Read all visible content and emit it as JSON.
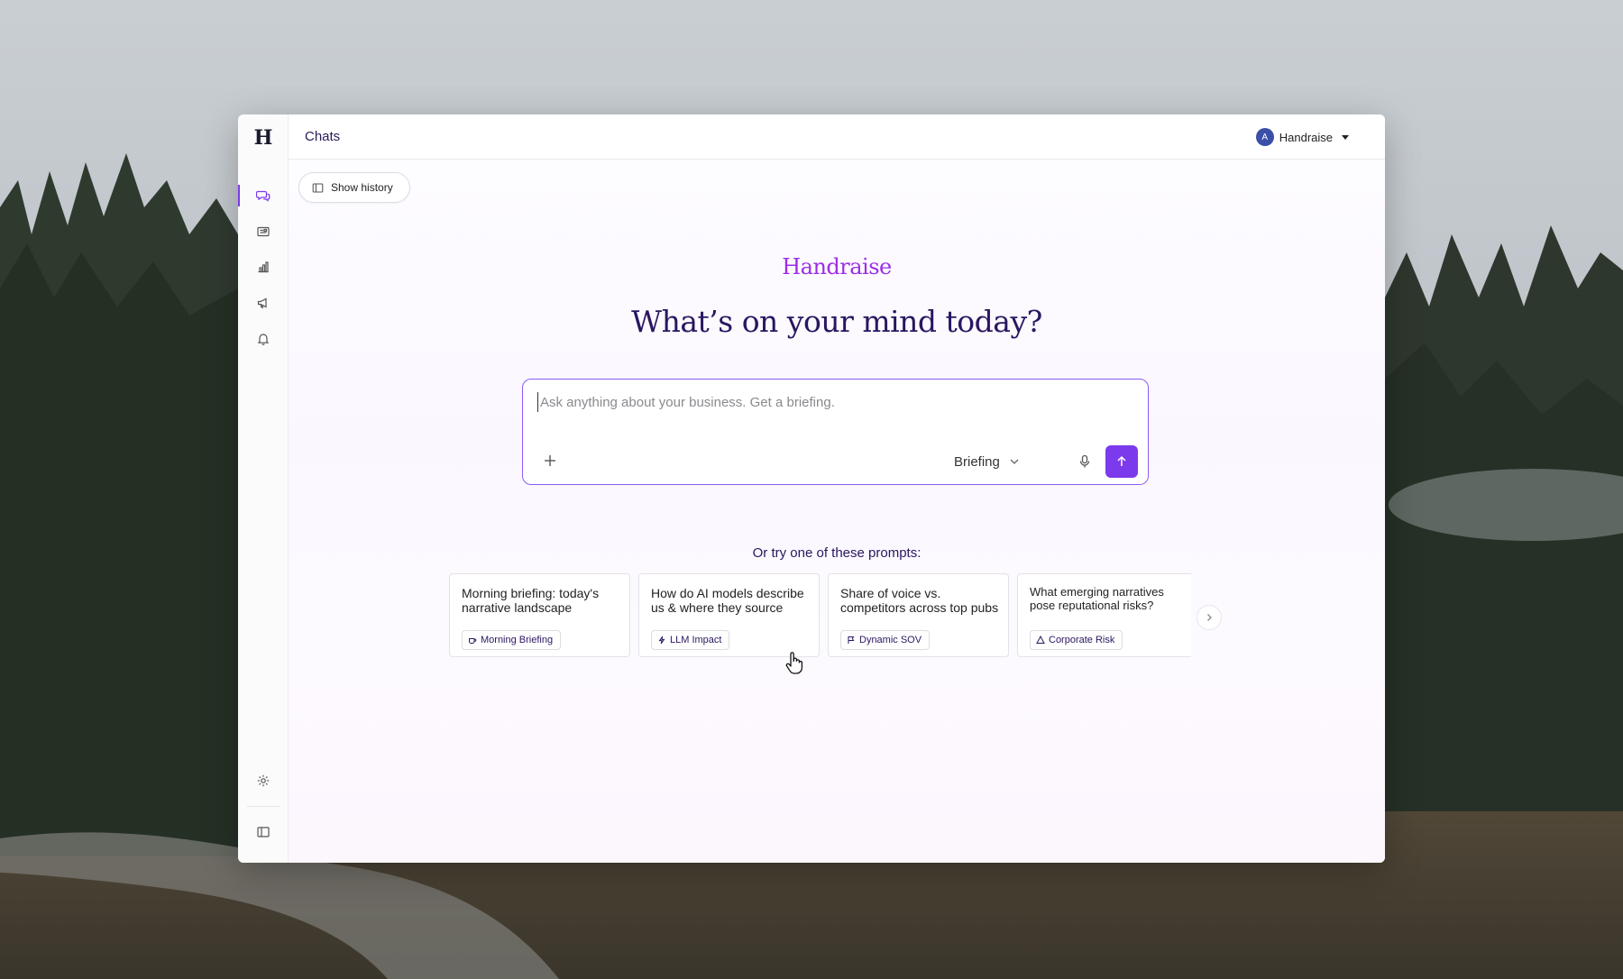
{
  "app": {
    "logo_letter": "H",
    "title": "Chats",
    "account": {
      "avatar_initial": "A",
      "name": "Handraise"
    }
  },
  "rail": {
    "items": [
      {
        "icon": "chat-icon",
        "active": true
      },
      {
        "icon": "newspaper-icon",
        "active": false
      },
      {
        "icon": "bar-chart-icon",
        "active": false
      },
      {
        "icon": "megaphone-icon",
        "active": false
      },
      {
        "icon": "bell-icon",
        "active": false
      }
    ],
    "bottom": [
      {
        "icon": "gear-icon"
      },
      {
        "icon": "sidebar-toggle-icon"
      }
    ]
  },
  "main": {
    "history_button": "Show history",
    "brand": "Handraise",
    "headline": "What’s on your mind today?",
    "composer": {
      "placeholder": "Ask anything about your business. Get a briefing.",
      "value": "",
      "mode": "Briefing"
    },
    "prompts_title": "Or try one of these prompts:",
    "prompts": [
      {
        "text": "Morning briefing: today's narrative landscape",
        "tag": "Morning Briefing",
        "tag_icon": "coffee-icon"
      },
      {
        "text": "How do AI models describe us & where they source",
        "tag": "LLM Impact",
        "tag_icon": "bolt-icon"
      },
      {
        "text": "Share of voice vs. competitors across top pubs",
        "tag": "Dynamic SOV",
        "tag_icon": "flag-icon"
      },
      {
        "text": "What emerging narratives pose reputational risks?",
        "tag": "Corporate Risk",
        "tag_icon": "warning-icon"
      }
    ]
  },
  "colors": {
    "accent": "#7c3aed",
    "brand": "#9b2ee6",
    "heading": "#2a1660"
  }
}
